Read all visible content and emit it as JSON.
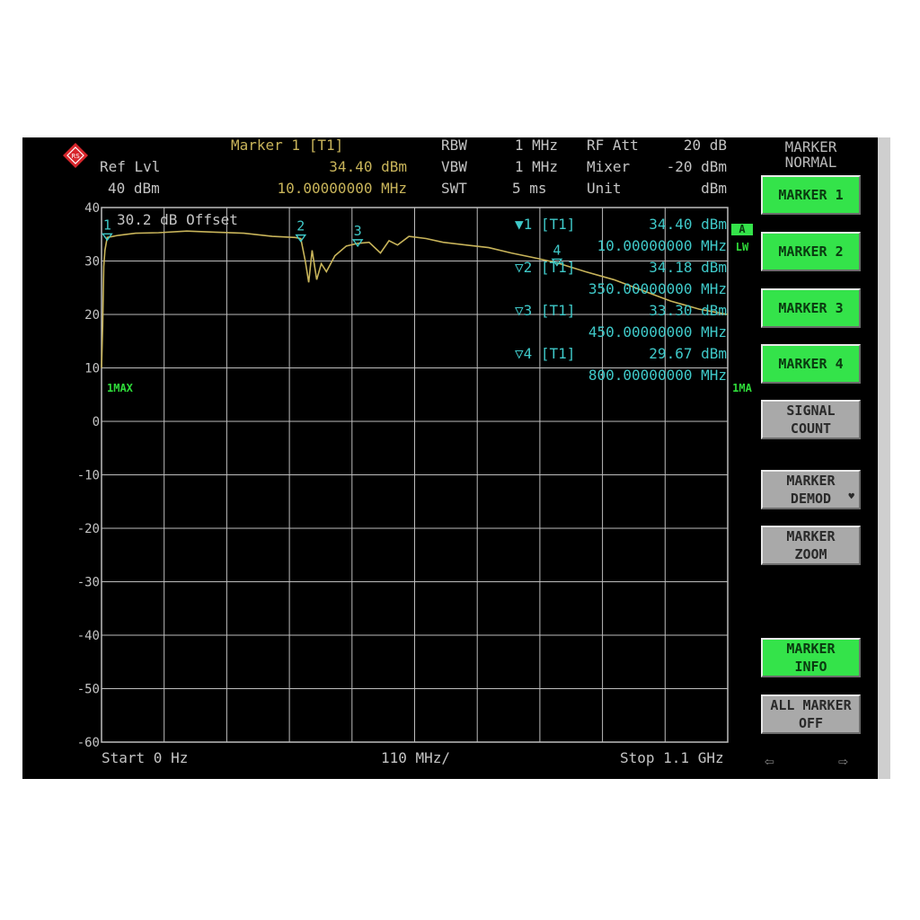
{
  "header": {
    "ref_label": "Ref Lvl",
    "ref_value": "40 dBm",
    "marker_title": "Marker 1 [T1]",
    "marker_level": "34.40 dBm",
    "marker_freq": "10.00000000 MHz",
    "rbw_label": "RBW",
    "rbw_value": "1 MHz",
    "vbw_label": "VBW",
    "vbw_value": "1 MHz",
    "swt_label": "SWT",
    "swt_value": "5 ms",
    "rfatt_label": "RF Att",
    "rfatt_value": "20 dB",
    "mixer_label": "Mixer",
    "mixer_value": "-20 dBm",
    "unit_label": "Unit",
    "unit_value": "dBm"
  },
  "plot": {
    "offset_label": "30.2 dB Offset",
    "trace_mode": "1MAX",
    "start_label": "Start 0 Hz",
    "span_label": "110 MHz/",
    "stop_label": "Stop 1.1 GHz",
    "y_ticks": [
      "40",
      "30",
      "20",
      "10",
      "0",
      "-10",
      "-20",
      "-30",
      "-40",
      "-50",
      "-60"
    ],
    "side_tag_a": "A",
    "side_tag_lw": "LW",
    "side_tag_1ma": "1MA"
  },
  "markers": [
    {
      "label": "1",
      "head": "▼1 [T1]",
      "level": "34.40 dBm",
      "freq": "10.00000000 MHz"
    },
    {
      "label": "2",
      "head": "▽2 [T1]",
      "level": "34.18 dBm",
      "freq": "350.00000000 MHz"
    },
    {
      "label": "3",
      "head": "▽3 [T1]",
      "level": "33.30 dBm",
      "freq": "450.00000000 MHz"
    },
    {
      "label": "4",
      "head": "▽4 [T1]",
      "level": "29.67 dBm",
      "freq": "800.00000000 MHz"
    }
  ],
  "chart_data": {
    "type": "line",
    "title": "",
    "xlabel": "",
    "ylabel": "",
    "xlim": [
      0,
      1100
    ],
    "ylim": [
      -60,
      40
    ],
    "x_unit": "MHz",
    "y_unit": "dBm",
    "grid": true,
    "series": [
      {
        "values": [
          [
            0,
            10
          ],
          [
            2,
            18
          ],
          [
            4,
            29
          ],
          [
            6,
            32
          ],
          [
            10,
            34.4
          ],
          [
            30,
            34.8
          ],
          [
            60,
            35.2
          ],
          [
            100,
            35.3
          ],
          [
            150,
            35.6
          ],
          [
            200,
            35.4
          ],
          [
            250,
            35.2
          ],
          [
            300,
            34.6
          ],
          [
            340,
            34.4
          ],
          [
            350,
            34.2
          ],
          [
            358,
            30
          ],
          [
            364,
            26
          ],
          [
            370,
            32
          ],
          [
            378,
            26.5
          ],
          [
            386,
            29.5
          ],
          [
            395,
            28
          ],
          [
            410,
            31
          ],
          [
            430,
            32.8
          ],
          [
            450,
            33.3
          ],
          [
            470,
            33.5
          ],
          [
            490,
            31.5
          ],
          [
            505,
            33.8
          ],
          [
            520,
            33
          ],
          [
            540,
            34.6
          ],
          [
            570,
            34.2
          ],
          [
            600,
            33.5
          ],
          [
            640,
            33
          ],
          [
            680,
            32.5
          ],
          [
            720,
            31.5
          ],
          [
            760,
            30.6
          ],
          [
            800,
            29.67
          ],
          [
            850,
            28
          ],
          [
            900,
            26.5
          ],
          [
            950,
            24.5
          ],
          [
            1000,
            22.5
          ],
          [
            1050,
            21
          ],
          [
            1100,
            20
          ]
        ]
      }
    ],
    "markers": [
      {
        "label": "1",
        "x": 10,
        "y": 34.4
      },
      {
        "label": "2",
        "x": 350,
        "y": 34.18
      },
      {
        "label": "3",
        "x": 450,
        "y": 33.3
      },
      {
        "label": "4",
        "x": 800,
        "y": 29.67
      }
    ]
  },
  "side": {
    "title": "MARKER\nNORMAL",
    "softkeys": [
      {
        "label": "MARKER 1",
        "state": "active"
      },
      {
        "label": "MARKER 2",
        "state": "active"
      },
      {
        "label": "MARKER 3",
        "state": "active"
      },
      {
        "label": "MARKER 4",
        "state": "active"
      },
      {
        "label": "SIGNAL\nCOUNT",
        "state": "inactive"
      },
      {
        "label": "MARKER\nDEMOD",
        "state": "inactive",
        "corner": "♥"
      },
      {
        "label": "MARKER\nZOOM",
        "state": "inactive"
      },
      {
        "label": "MARKER\nINFO",
        "state": "active"
      },
      {
        "label": "ALL MARKER\nOFF",
        "state": "inactive"
      }
    ],
    "nav_left": "⇦",
    "nav_right": "⇨"
  },
  "colors": {
    "trace": "#c8b45a",
    "grid": "#bdbdbd",
    "marker": "#3fc9c9",
    "softkey_active": "#34e34a",
    "softkey_inactive": "#a9a9a9"
  }
}
